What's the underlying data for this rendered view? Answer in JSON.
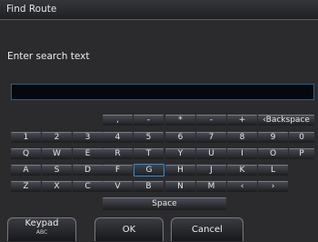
{
  "window": {
    "title": "Find Route"
  },
  "search": {
    "prompt": "Enter search text",
    "value": ""
  },
  "keyboard": {
    "rows": [
      [
        ",",
        "-",
        "*",
        "-",
        "+",
        "‹Backspace"
      ],
      [
        "1",
        "2",
        "3",
        "4",
        "5",
        "6",
        "7",
        "8",
        "9",
        "0"
      ],
      [
        "Q",
        "W",
        "E",
        "R",
        "T",
        "Y",
        "U",
        "I",
        "O",
        "P"
      ],
      [
        "A",
        "S",
        "D",
        "F",
        "G",
        "H",
        "J",
        "K",
        "L"
      ],
      [
        "Z",
        "X",
        "C",
        "V",
        "B",
        "N",
        "M",
        "‹",
        "›"
      ],
      [
        "Space"
      ]
    ],
    "selected_key": "G"
  },
  "softkeys": {
    "keypad": {
      "label": "Keypad",
      "sub": "ABC"
    },
    "ok": {
      "label": "OK"
    },
    "cancel": {
      "label": "Cancel"
    }
  }
}
